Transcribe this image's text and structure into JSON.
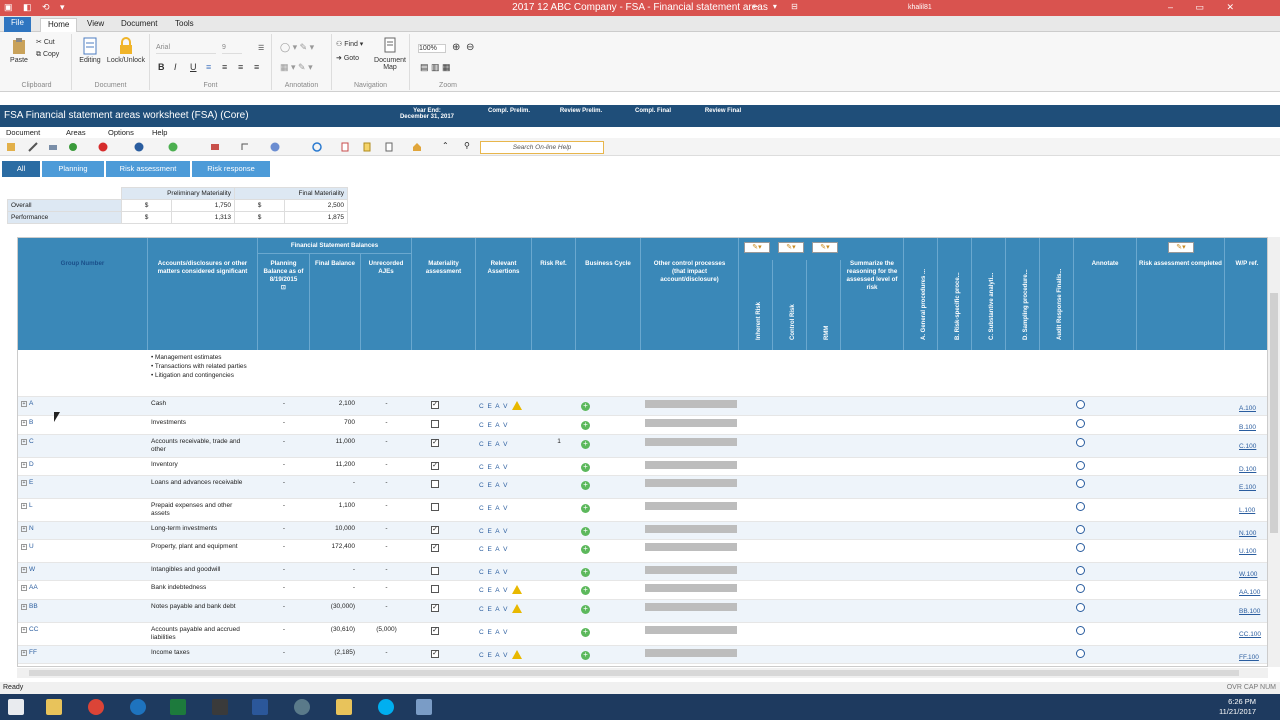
{
  "window": {
    "title": "2017 12 ABC Company - FSA - Financial statement areas",
    "user": "khalil81"
  },
  "ribbon_tabs": [
    "File",
    "Home",
    "View",
    "Document",
    "Tools"
  ],
  "ribbon": {
    "paste": "Paste",
    "cut": "Cut",
    "copy": "Copy",
    "clipboard": "Clipboard",
    "editing": "Editing",
    "lock": "Lock/Unlock",
    "document": "Document",
    "font_name": "Arial",
    "font_size": "9",
    "font": "Font",
    "annotation": "Annotation",
    "find": "Find",
    "goto": "Goto",
    "docmap": "Document Map",
    "navigation": "Navigation",
    "zoom_value": "100%",
    "zoom": "Zoom"
  },
  "fsa": {
    "title": "FSA Financial statement areas worksheet (FSA) (Core)",
    "year_end_label": "Year End:",
    "year_end_value": "December 31, 2017",
    "compl_prelim": "Compl. Prelim.",
    "review_prelim": "Review Prelim.",
    "compl_final": "Compl. Final",
    "review_final": "Review Final"
  },
  "menu": [
    "Document",
    "Areas",
    "Options",
    "Help"
  ],
  "search_help": "Search On-line Help",
  "area_tabs": [
    "All",
    "Planning",
    "Risk assessment",
    "Risk response"
  ],
  "materiality": {
    "prelim": "Preliminary Materiality",
    "final": "Final Materiality",
    "rows": [
      {
        "label": "Overall",
        "cur1": "$",
        "v1": "1,750",
        "cur2": "$",
        "v2": "2,500"
      },
      {
        "label": "Performance",
        "cur1": "$",
        "v1": "1,313",
        "cur2": "$",
        "v2": "1,875"
      }
    ]
  },
  "headers": {
    "group": "Group Number",
    "accounts": "Accounts/disclosures or other matters considered significant",
    "fsb": "Financial Statement Balances",
    "planning": "Planning Balance as of 8/19/2015",
    "final": "Final Balance",
    "unrec": "Unrecorded AJEs",
    "mat": "Materiality assessment",
    "assert": "Relevant Assertions",
    "risk": "Risk Ref.",
    "bc": "Business Cycle",
    "ocp": "Other control processes (that impact account/disclosure)",
    "ir": "Inherent Risk",
    "cr": "Control Risk",
    "rmm": "RMM",
    "sum": "Summarize the reasoning for the assessed level of risk",
    "a": "A. General procedures ...",
    "b": "B. Risk-specific proce...",
    "cc": "C. Substantive analyti...",
    "d": "D. Sampling procedure...",
    "aud": "Audit Response Finalis...",
    "ann": "Annotate",
    "rac": "Risk assessment completed",
    "wp": "W/P ref."
  },
  "notes": [
    "• Management estimates",
    "• Transactions with related parties",
    "• Litigation and contingencies"
  ],
  "rows": [
    {
      "g": "A",
      "acct": "Cash",
      "plan": "-",
      "fin": "2,100",
      "unr": "-",
      "chk": true,
      "ceav": "C E A V",
      "warn": true,
      "rr": "",
      "wp": "A.100"
    },
    {
      "g": "B",
      "acct": "Investments",
      "plan": "-",
      "fin": "700",
      "unr": "-",
      "chk": false,
      "ceav": "C E A V",
      "warn": false,
      "rr": "",
      "wp": "B.100"
    },
    {
      "g": "C",
      "acct": "Accounts receivable, trade and other",
      "plan": "-",
      "fin": "11,000",
      "unr": "-",
      "chk": true,
      "ceav": "C E A V",
      "warn": false,
      "rr": "1",
      "wp": "C.100"
    },
    {
      "g": "D",
      "acct": "Inventory",
      "plan": "-",
      "fin": "11,200",
      "unr": "-",
      "chk": true,
      "ceav": "C E A V",
      "warn": false,
      "rr": "",
      "wp": "D.100"
    },
    {
      "g": "E",
      "acct": "Loans and advances receivable",
      "plan": "-",
      "fin": "-",
      "unr": "-",
      "chk": false,
      "ceav": "C E A V",
      "warn": false,
      "rr": "",
      "wp": "E.100"
    },
    {
      "g": "L",
      "acct": "Prepaid expenses and other assets",
      "plan": "-",
      "fin": "1,100",
      "unr": "-",
      "chk": false,
      "ceav": "C E A V",
      "warn": false,
      "rr": "",
      "wp": "L.100"
    },
    {
      "g": "N",
      "acct": "Long-term investments",
      "plan": "-",
      "fin": "10,000",
      "unr": "-",
      "chk": true,
      "ceav": "C E A V",
      "warn": false,
      "rr": "",
      "wp": "N.100"
    },
    {
      "g": "U",
      "acct": "Property, plant and equipment",
      "plan": "-",
      "fin": "172,400",
      "unr": "-",
      "chk": true,
      "ceav": "C E A V",
      "warn": false,
      "rr": "",
      "wp": "U.100"
    },
    {
      "g": "W",
      "acct": "Intangibles and goodwill",
      "plan": "-",
      "fin": "-",
      "unr": "-",
      "chk": false,
      "ceav": "C E A V",
      "warn": false,
      "rr": "",
      "wp": "W.100"
    },
    {
      "g": "AA",
      "acct": "Bank indebtedness",
      "plan": "-",
      "fin": "-",
      "unr": "-",
      "chk": false,
      "ceav": "C E A V",
      "warn": true,
      "rr": "",
      "wp": "AA.100"
    },
    {
      "g": "BB",
      "acct": "Notes payable and bank debt",
      "plan": "-",
      "fin": "(30,000)",
      "unr": "-",
      "chk": true,
      "ceav": "C E A V",
      "warn": true,
      "rr": "",
      "wp": "BB.100"
    },
    {
      "g": "CC",
      "acct": "Accounts payable and accrued liabilities",
      "plan": "-",
      "fin": "(30,610)",
      "unr": "(5,000)",
      "chk": true,
      "ceav": "C E A V",
      "warn": false,
      "rr": "",
      "wp": "CC.100"
    },
    {
      "g": "FF",
      "acct": "Income taxes",
      "plan": "-",
      "fin": "(2,185)",
      "unr": "-",
      "chk": true,
      "ceav": "C E A V",
      "warn": true,
      "rr": "",
      "wp": "FF.100"
    }
  ],
  "status": {
    "left": "Ready",
    "right": "OVR CAP NUM"
  },
  "clock": {
    "time": "6:26 PM",
    "date": "11/21/2017"
  }
}
